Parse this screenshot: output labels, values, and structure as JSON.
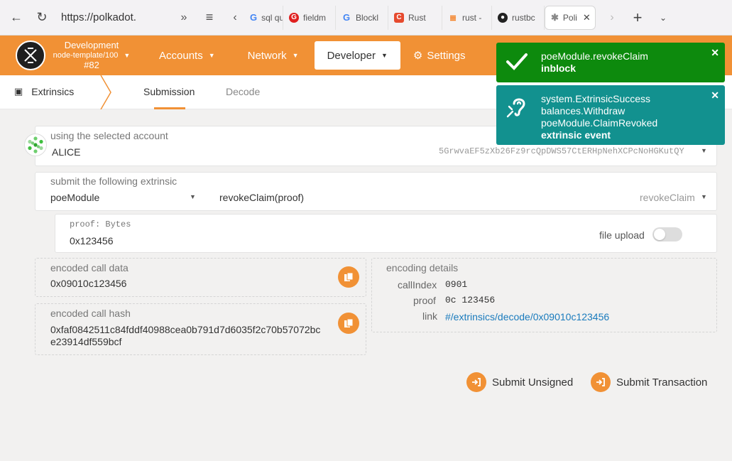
{
  "browser": {
    "url": "https://polkadot.",
    "tabs": [
      {
        "label": "sql qu",
        "icon": "google-icon",
        "color": "#4285f4"
      },
      {
        "label": "fieldm",
        "icon": "grammarly-icon",
        "color": "#e02020"
      },
      {
        "label": "Blockl",
        "icon": "google-icon",
        "color": "#4285f4"
      },
      {
        "label": "Rust",
        "icon": "c-icon",
        "color": "#e64a2e"
      },
      {
        "label": "rust -",
        "icon": "stackoverflow-icon",
        "color": "#f48024"
      },
      {
        "label": "rustbc",
        "icon": "github-icon",
        "color": "#222222"
      },
      {
        "label": "Poli",
        "icon": "polkadot-icon",
        "color": "#888888"
      }
    ]
  },
  "header": {
    "chain_name": "Development",
    "chain_version": "node-template/100",
    "block": "#82",
    "menu": [
      "Accounts",
      "Network",
      "Developer",
      "Settings"
    ]
  },
  "subnav": {
    "section": "Extrinsics",
    "tabs": [
      "Submission",
      "Decode"
    ]
  },
  "account": {
    "label": "using the selected account",
    "name": "ALICE",
    "address": "5GrwvaEF5zXb26Fz9rcQpDWS57CtERHpNehXCPcNoHGKutQY"
  },
  "extrinsic": {
    "label": "submit the following extrinsic",
    "module": "poeModule",
    "call": "revokeClaim(proof)",
    "call_name": "revokeClaim"
  },
  "param": {
    "label": "proof: Bytes",
    "value": "0x123456",
    "file_upload": "file upload"
  },
  "encoded_call_data": {
    "label": "encoded call data",
    "value": "0x09010c123456"
  },
  "encoded_call_hash": {
    "label": "encoded call hash",
    "line1": "0xfaf0842511c84fddf40988cea0b791d7d6035f2c70b57072bc",
    "line2": "e23914df559bcf"
  },
  "encoding_details": {
    "label": "encoding details",
    "callIndex_label": "callIndex",
    "callIndex_value": "0901",
    "proof_label": "proof",
    "proof_value": "0c 123456",
    "link_label": "link",
    "link_value": "#/extrinsics/decode/0x09010c123456"
  },
  "actions": {
    "submit_unsigned": "Submit Unsigned",
    "submit_transaction": "Submit Transaction"
  },
  "notifications": [
    {
      "line1": "poeModule.revokeClaim",
      "line2": "inblock",
      "color": "#0d8a0d"
    },
    {
      "line1": "system.ExtrinsicSuccess",
      "line2": "balances.Withdraw",
      "line3": "poeModule.ClaimRevoked",
      "line4": "extrinsic event",
      "color": "#12918f"
    }
  ],
  "colors": {
    "accent": "#f19135",
    "link": "#1a7bbd"
  }
}
